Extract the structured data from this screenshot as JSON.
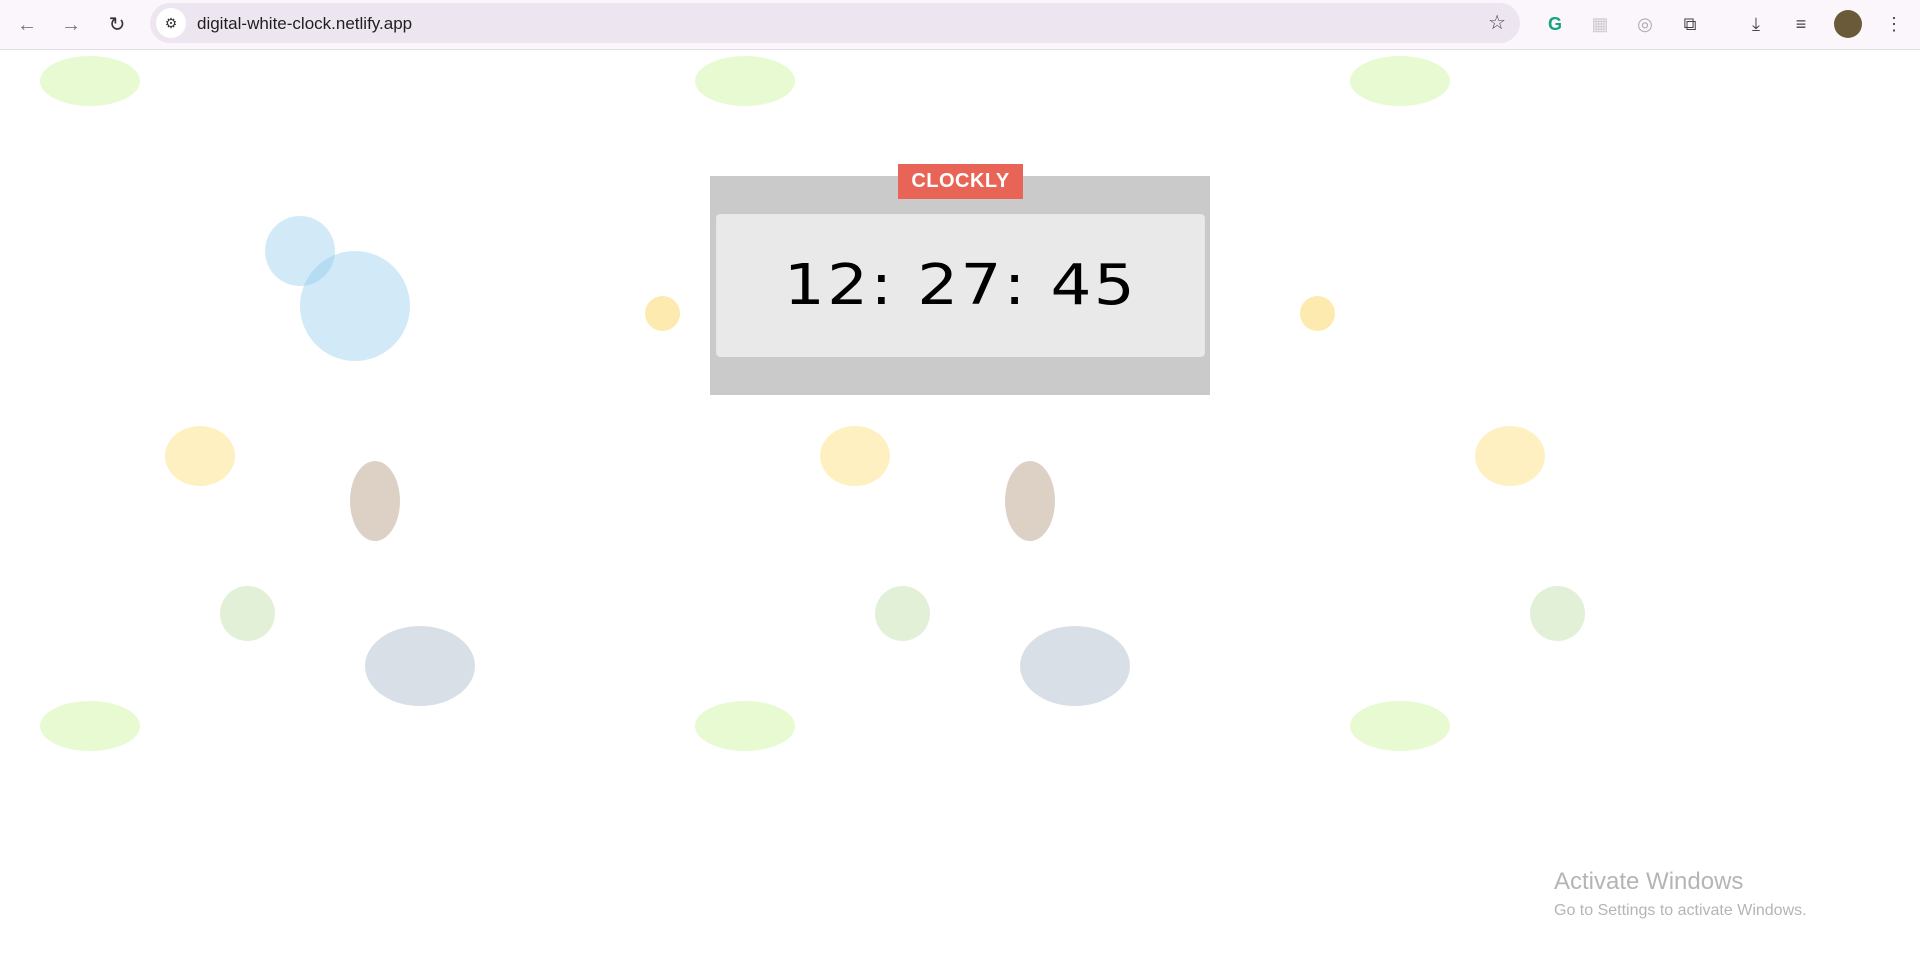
{
  "browser": {
    "url": "digital-white-clock.netlify.app",
    "back_icon": "arrow-left",
    "forward_icon": "arrow-right",
    "reload_icon": "reload",
    "bookmark_icon": "star"
  },
  "app": {
    "brand": "CLOCKLY",
    "time": "12: 27: 45",
    "brand_color": "#e76456",
    "frame_color": "#cacaca",
    "face_color": "#e9e9e9"
  },
  "watermark": {
    "title": "Activate Windows",
    "subtitle": "Go to Settings to activate Windows."
  }
}
